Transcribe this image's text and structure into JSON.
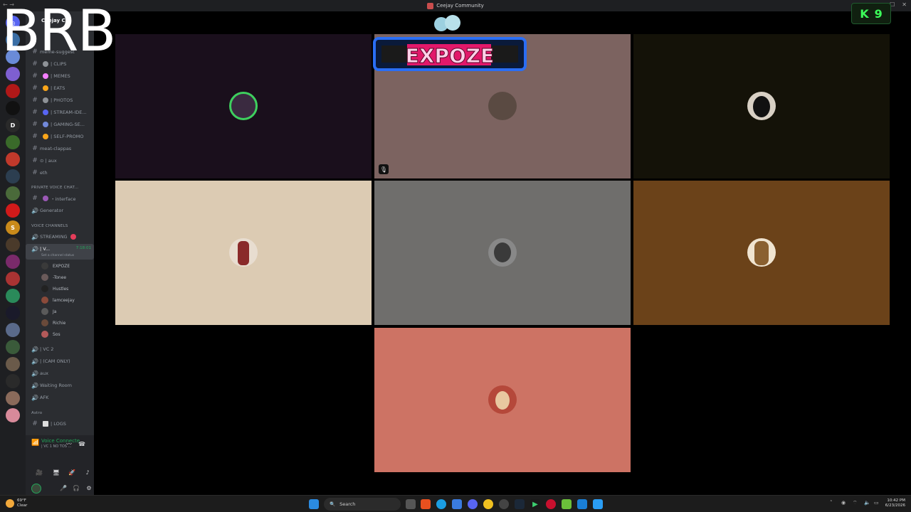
{
  "window": {
    "title": "Ceejay Community",
    "nav": "← →"
  },
  "overlay": {
    "brb": "BRB"
  },
  "badge": {
    "icon": "kick-icon",
    "k": "K",
    "count": "9"
  },
  "server": {
    "name": "Ceejay C..."
  },
  "channels": [
    {
      "name": "| CLIPS",
      "emoji_color": "#8e9297"
    },
    {
      "name": "| MEMES",
      "emoji_color": "#f47fff"
    },
    {
      "name": "| EATS",
      "emoji_color": "#faa61a"
    },
    {
      "name": "| PHOTOS",
      "emoji_color": "#8e9297"
    },
    {
      "name": "| STREAM-IDE...",
      "emoji_color": "#5865f2"
    },
    {
      "name": "| GAMING-SE...",
      "emoji_color": "#7289da"
    },
    {
      "name": "| SELF-PROMO",
      "emoji_color": "#faa61a"
    }
  ],
  "plain_channels": [
    "meat-clappas",
    "⊙ | aux",
    "eth"
  ],
  "header_channel": "meme-suggest",
  "private_category": "PRIVATE VOICE CHAT...",
  "private_channels": [
    "・interface",
    "Generator"
  ],
  "voice_category": "VOICE CHANNELS",
  "streaming_channel": "STREAMING",
  "active_voice": {
    "name": "| V...",
    "time": "7:18:01",
    "status": "Set a channel status"
  },
  "members": [
    {
      "name": "EXPOZE",
      "color": "#3a3a3a"
    },
    {
      "name": "-Tonee",
      "color": "#6a5a5a"
    },
    {
      "name": "Hustles",
      "color": "#222"
    },
    {
      "name": "lamceejay",
      "color": "#8b4a3a"
    },
    {
      "name": "Ja",
      "color": "#5a5a5a"
    },
    {
      "name": "Richie",
      "color": "#6a4a3a"
    },
    {
      "name": "Sos",
      "color": "#b45a5a"
    }
  ],
  "other_voice": [
    "| VC 2",
    "| (CAM ONLY)",
    "aux",
    "Waiting Room",
    "AFK"
  ],
  "astro_category": "Astro",
  "logs_channel": "| LOGS",
  "voice_panel": {
    "title": "Voice Connecte",
    "sub": "| VC 1 NO TOS ..."
  },
  "tiles": [
    {
      "bg": "#1a0f1c",
      "avatar": "#3a2a40",
      "ring": "#3ecf5e"
    },
    {
      "bg": "#7c6360",
      "avatar": "#5a4a42",
      "ring": ""
    },
    {
      "bg": "#141208",
      "avatar": "#d8d0c4",
      "ring": ""
    },
    {
      "bg": "#dccbb3",
      "avatar": "#8a2a2a",
      "ring": ""
    },
    {
      "bg": "#6f6e6c",
      "avatar": "#444",
      "ring": ""
    },
    {
      "bg": "#6b4219",
      "avatar": "#c9a37a",
      "ring": ""
    },
    {
      "bg": "#cd7364",
      "avatar": "#b5483a",
      "ring": ""
    }
  ],
  "banner": {
    "text": "EXPOZE"
  },
  "taskbar": {
    "search": "Search",
    "weather_temp": "69°F",
    "weather_desc": "Clear",
    "time": "10:42 PM",
    "date": "6/23/2026"
  }
}
